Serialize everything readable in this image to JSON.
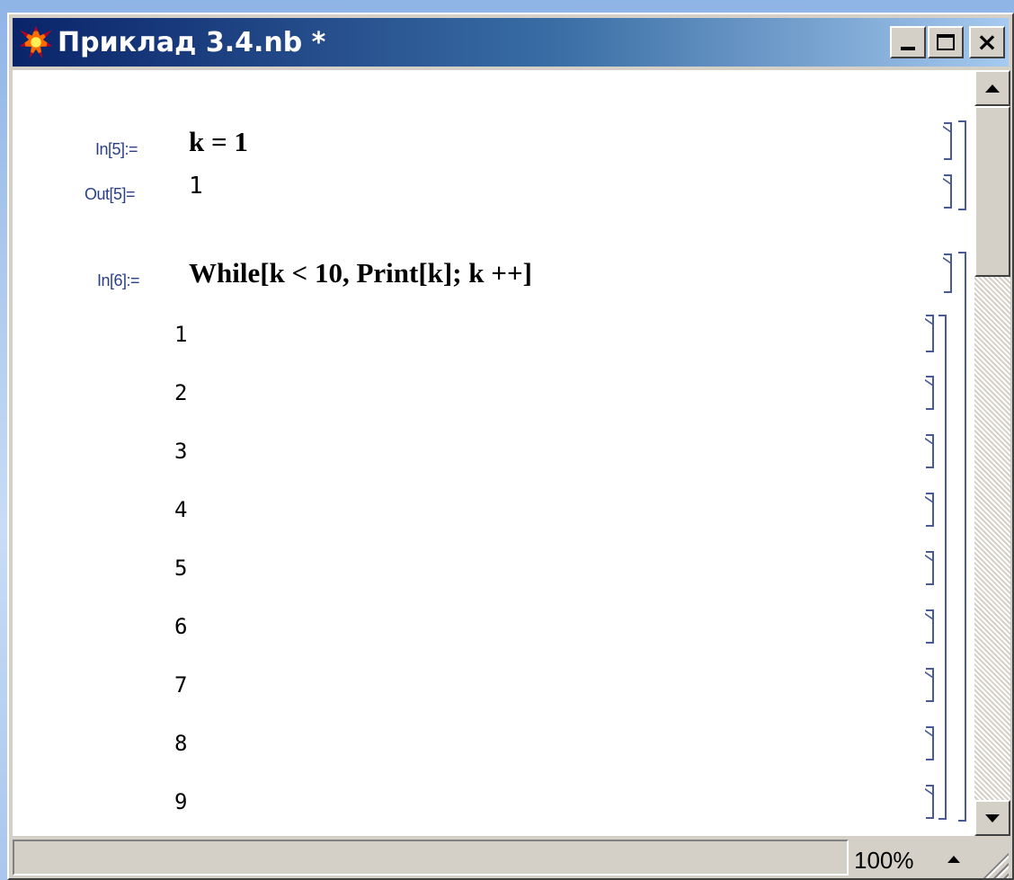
{
  "window": {
    "title": "Приклад 3.4.nb *",
    "close_glyph": "×"
  },
  "cells": {
    "in5_label": "In[5]:=",
    "in5_input": "k = 1",
    "out5_label": "Out[5]=",
    "out5_value": "1",
    "in6_label": "In[6]:=",
    "in6_input": "While[k < 10, Print[k]; k ++]",
    "printed": [
      "1",
      "2",
      "3",
      "4",
      "5",
      "6",
      "7",
      "8",
      "9"
    ]
  },
  "statusbar": {
    "zoom": "100%"
  },
  "colors": {
    "titlebar_start": "#0a246a",
    "titlebar_end": "#a6caf0",
    "label_blue": "#2a3f8a",
    "bracket_blue": "#4a5a96",
    "chrome": "#d4d0c8"
  },
  "icons": {
    "app": "mathematica-star-icon",
    "minimize": "minimize-icon",
    "maximize": "maximize-icon",
    "close": "close-icon",
    "scroll_up": "scroll-up-arrow-icon",
    "scroll_down": "scroll-down-arrow-icon",
    "zoom_menu": "zoom-menu-arrow-icon",
    "resize": "resize-grip-icon"
  }
}
